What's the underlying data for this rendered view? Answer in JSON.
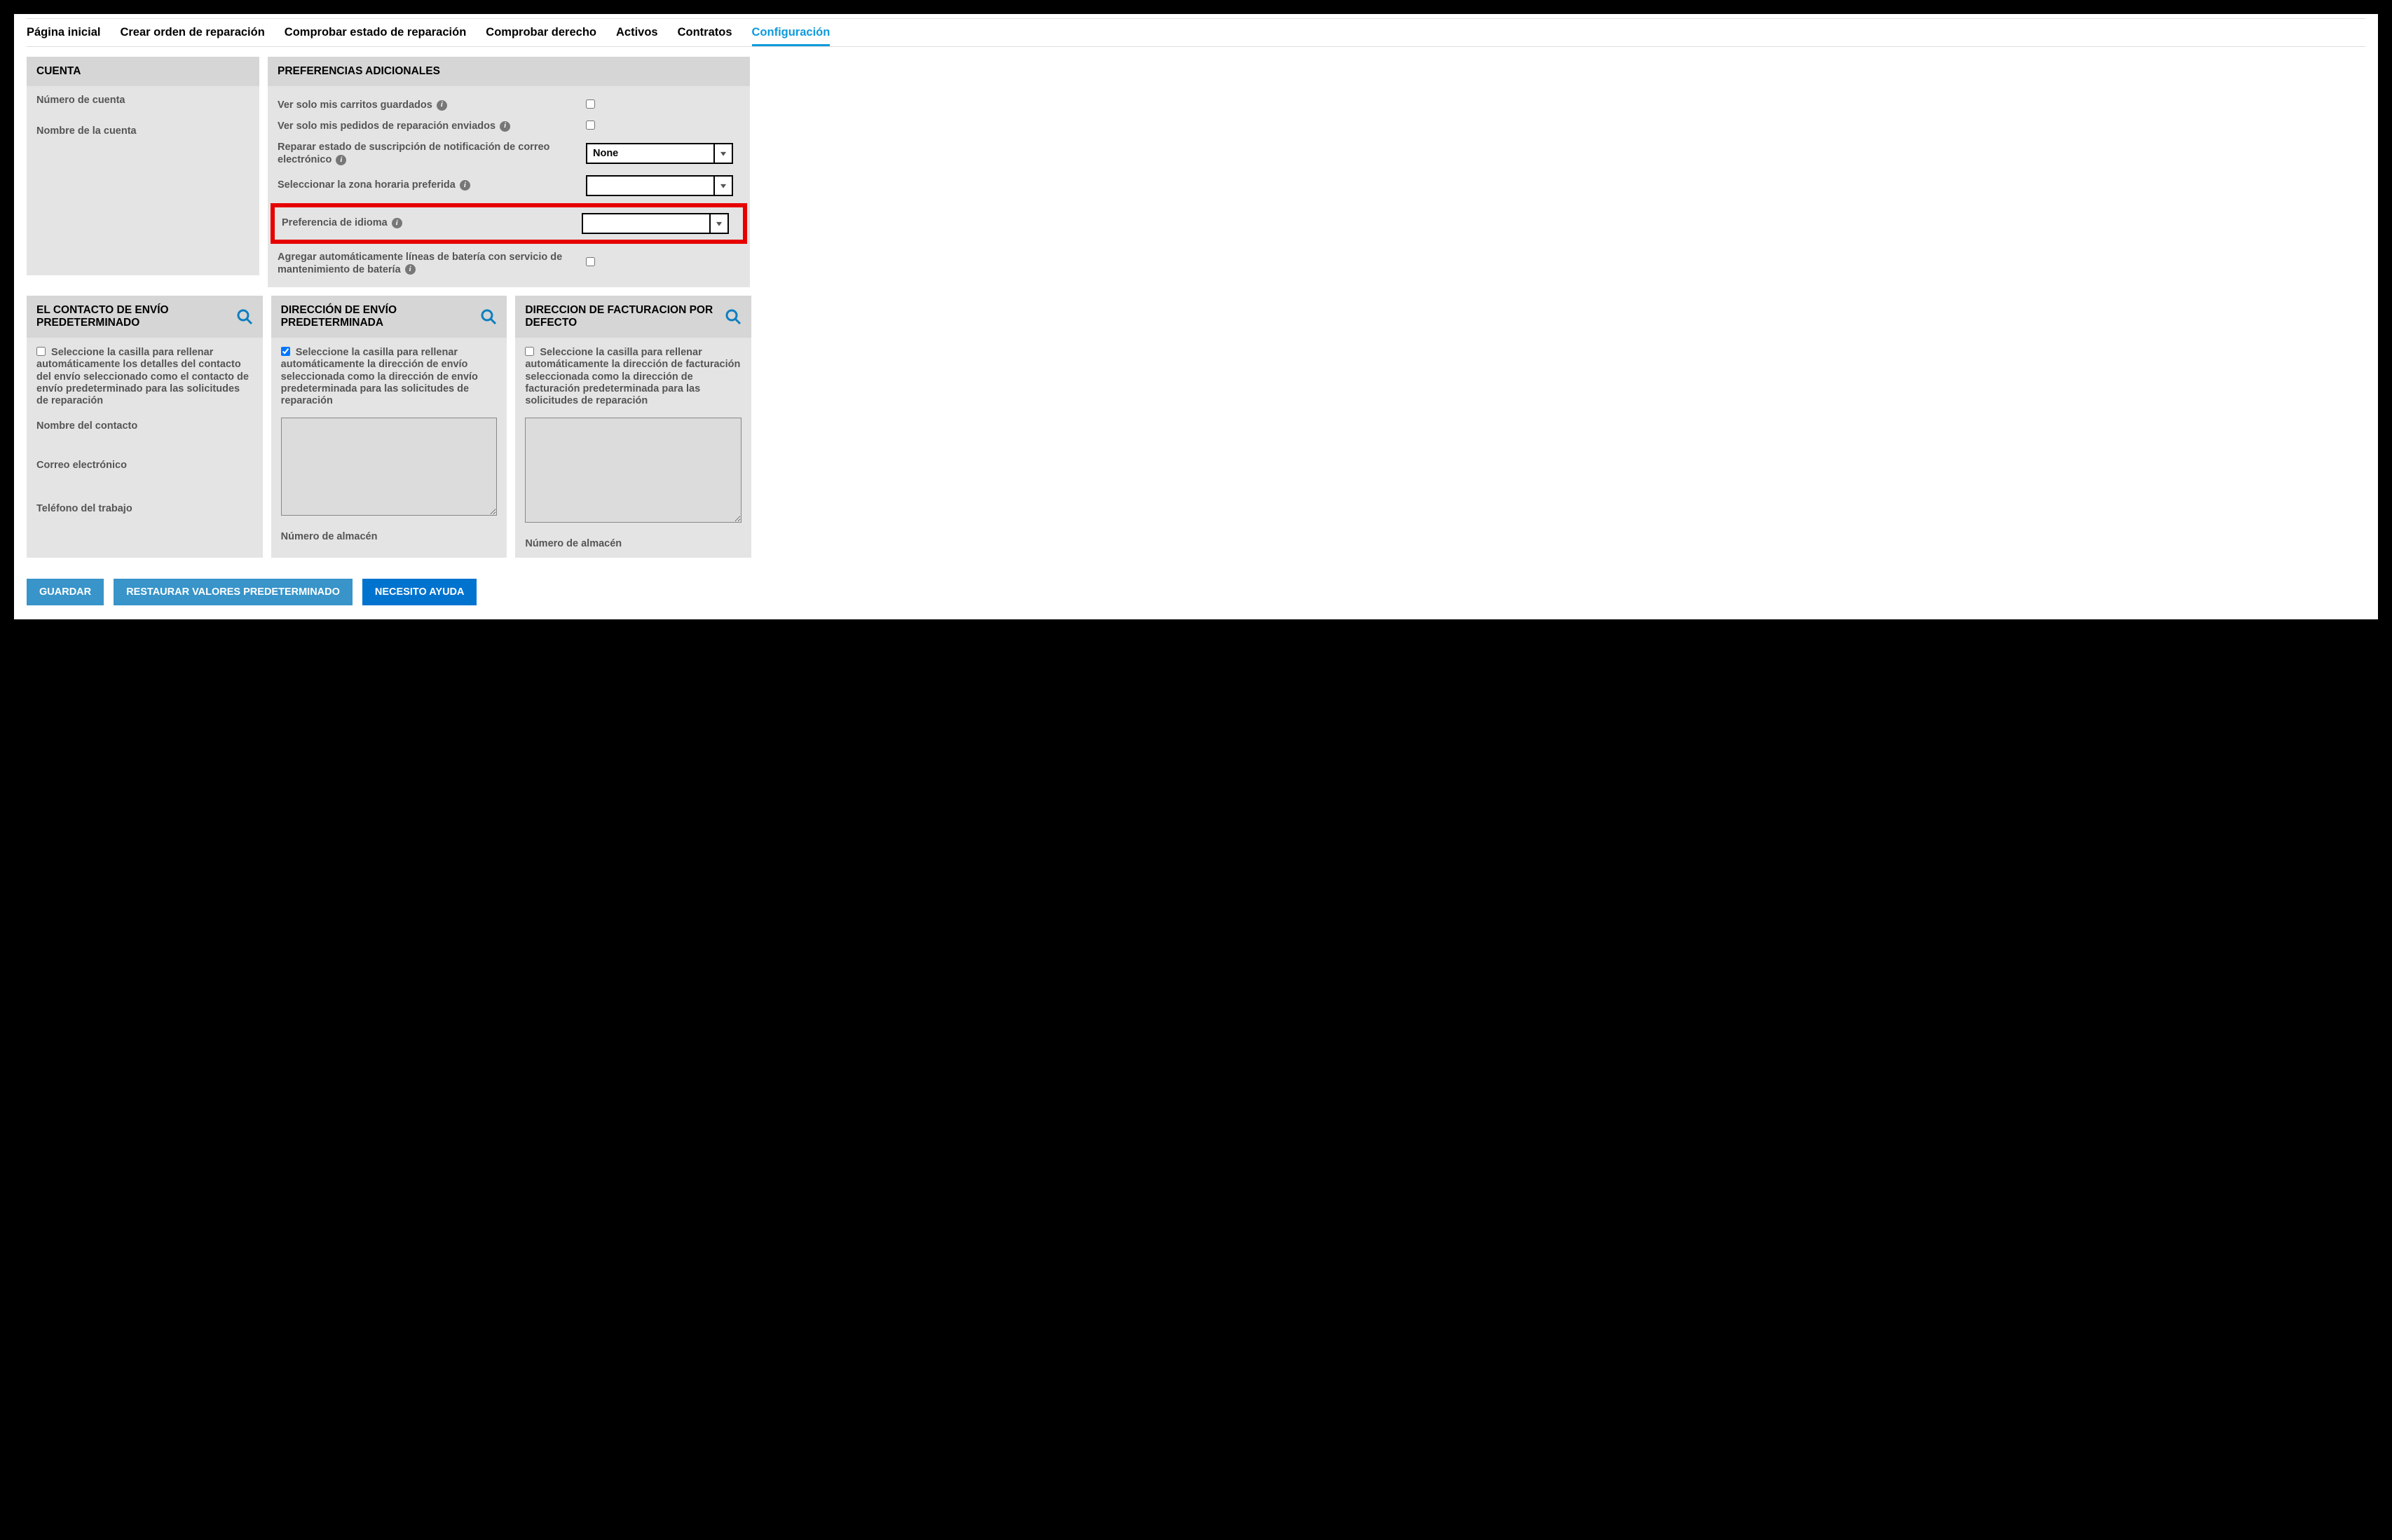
{
  "tabs": {
    "home": "Página inicial",
    "create": "Crear orden de reparación",
    "check_repair": "Comprobar estado de reparación",
    "check_entitlement": "Comprobar derecho",
    "assets": "Activos",
    "contracts": "Contratos",
    "config": "Configuración"
  },
  "account": {
    "title": "CUENTA",
    "number_label": "Número de cuenta",
    "name_label": "Nombre de la cuenta"
  },
  "prefs": {
    "title": "PREFERENCIAS ADICIONALES",
    "only_my_carts": "Ver solo mis carritos guardados",
    "only_my_orders": "Ver solo mis pedidos de reparación enviados",
    "email_subscription": "Reparar estado de suscripción de notificación de correo electrónico",
    "email_subscription_value": "None",
    "timezone": "Seleccionar la zona horaria preferida",
    "timezone_value": "",
    "language": "Preferencia de idioma",
    "language_value": "",
    "auto_battery": "Agregar automáticamente líneas de batería con servicio de mantenimiento de batería"
  },
  "ship_contact": {
    "title": "EL CONTACTO DE ENVÍO PREDETERMINADO",
    "checkbox_text": "Seleccione la casilla para rellenar automáticamente los detalles del contacto del envío seleccionado como el contacto de envío predeterminado para las solicitudes de reparación",
    "contact_name": "Nombre del contacto",
    "email": "Correo electrónico",
    "phone": "Teléfono del trabajo"
  },
  "ship_address": {
    "title": "DIRECCIÓN DE ENVÍO PREDETERMINADA",
    "checkbox_text": "Seleccione la casilla para rellenar automáticamente la dirección de envío seleccionada como la dirección de envío predeterminada para las solicitudes de reparación",
    "warehouse": "Número de almacén"
  },
  "bill_address": {
    "title": "DIRECCION DE FACTURACION POR DEFECTO",
    "checkbox_text": "Seleccione la casilla para rellenar automáticamente la dirección de facturación seleccionada como la dirección de facturación predeterminada para las solicitudes de reparación",
    "warehouse": "Número de almacén"
  },
  "buttons": {
    "save": "GUARDAR",
    "restore": "RESTAURAR VALORES PREDETERMINADO",
    "help": "NECESITO AYUDA"
  }
}
